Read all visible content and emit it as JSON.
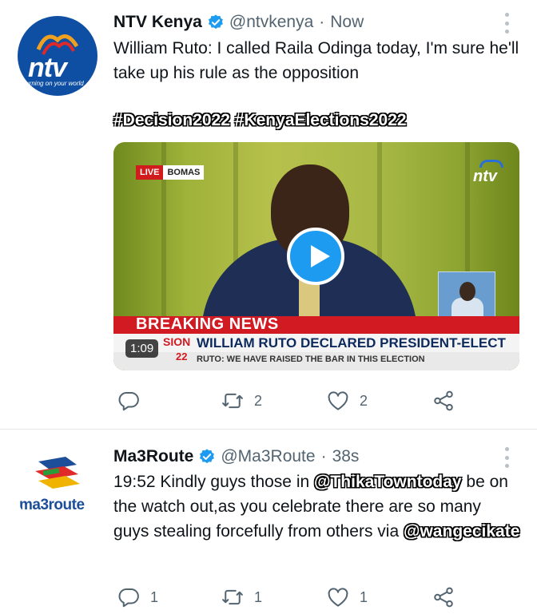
{
  "tweets": [
    {
      "display_name": "NTV Kenya",
      "handle": "@ntvkenya",
      "time": "Now",
      "text": "William Ruto: I called Raila Odinga today, I'm sure he'll take up his rule as the opposition",
      "hashtags": "#Decision2022 #KenyaElections2022",
      "avatar_text": "ntv",
      "avatar_tagline": "turning on your world",
      "media": {
        "live_label": "LIVE",
        "location_label": "BOMAS",
        "channel_logo": "ntv",
        "breaking_label": "BREAKING NEWS",
        "headline_prefix": "SION",
        "headline": "WILLIAM RUTO  DECLARED PRESIDENT-ELECT",
        "year_badge": "22",
        "subheadline": "RUTO: WE HAVE RAISED THE BAR IN THIS ELECTION",
        "duration": "1:09",
        "play_icon": "play-icon"
      },
      "actions": {
        "reply": "",
        "retweet": "2",
        "like": "2"
      }
    },
    {
      "display_name": "Ma3Route",
      "handle": "@Ma3Route",
      "time": "38s",
      "text_part1": "19:52 Kindly guys those in ",
      "mention1": "@ThikaTowntoday",
      "text_part2": " be on the watch out,as you celebrate there are so many guys stealing forcefully from others via ",
      "mention2": "@wangecikate",
      "avatar_text": "ma3route",
      "actions": {
        "reply": "1",
        "retweet": "1",
        "like": "1"
      }
    }
  ],
  "colors": {
    "verified": "#1d9bf0",
    "muted": "#536471",
    "accent": "#1d9bf0"
  }
}
